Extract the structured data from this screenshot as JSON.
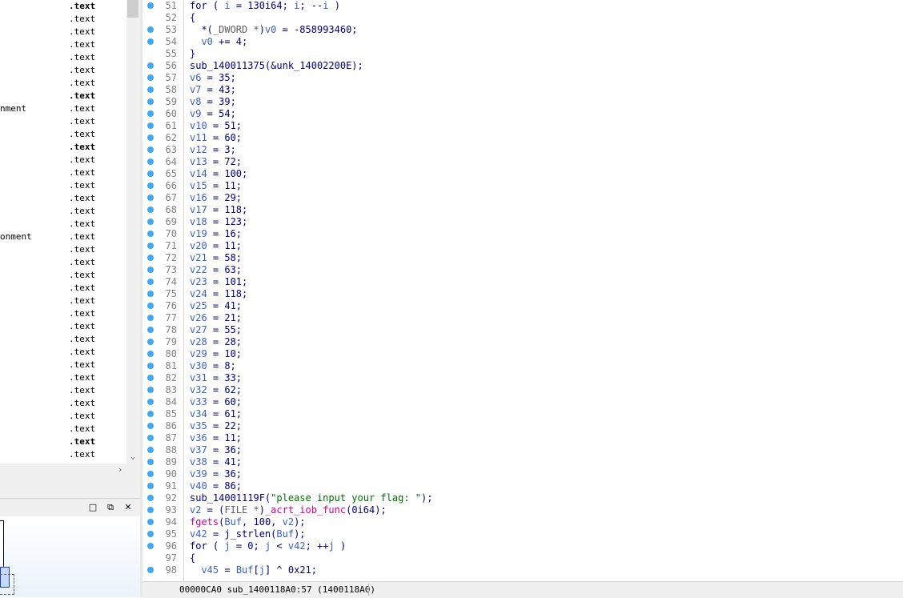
{
  "function_list": {
    "rows": [
      {
        "name": "",
        "segment": ".text",
        "bold": true
      },
      {
        "name": "",
        "segment": ".text",
        "bold": false
      },
      {
        "name": "",
        "segment": ".text",
        "bold": false
      },
      {
        "name": "",
        "segment": ".text",
        "bold": false
      },
      {
        "name": "",
        "segment": ".text",
        "bold": false
      },
      {
        "name": "",
        "segment": ".text",
        "bold": false
      },
      {
        "name": "",
        "segment": ".text",
        "bold": false
      },
      {
        "name": "",
        "segment": ".text",
        "bold": true
      },
      {
        "name": "nment",
        "segment": ".text",
        "bold": false
      },
      {
        "name": "",
        "segment": ".text",
        "bold": false
      },
      {
        "name": "",
        "segment": ".text",
        "bold": false
      },
      {
        "name": "",
        "segment": ".text",
        "bold": true
      },
      {
        "name": "",
        "segment": ".text",
        "bold": false
      },
      {
        "name": "",
        "segment": ".text",
        "bold": false
      },
      {
        "name": "",
        "segment": ".text",
        "bold": false
      },
      {
        "name": "",
        "segment": ".text",
        "bold": false
      },
      {
        "name": "",
        "segment": ".text",
        "bold": false
      },
      {
        "name": "",
        "segment": ".text",
        "bold": false
      },
      {
        "name": "onment",
        "segment": ".text",
        "bold": false
      },
      {
        "name": "",
        "segment": ".text",
        "bold": false
      },
      {
        "name": "",
        "segment": ".text",
        "bold": false
      },
      {
        "name": "",
        "segment": ".text",
        "bold": false
      },
      {
        "name": "",
        "segment": ".text",
        "bold": false
      },
      {
        "name": "",
        "segment": ".text",
        "bold": false
      },
      {
        "name": "",
        "segment": ".text",
        "bold": false
      },
      {
        "name": "",
        "segment": ".text",
        "bold": false
      },
      {
        "name": "",
        "segment": ".text",
        "bold": false
      },
      {
        "name": "",
        "segment": ".text",
        "bold": false
      },
      {
        "name": "",
        "segment": ".text",
        "bold": false
      },
      {
        "name": "",
        "segment": ".text",
        "bold": false
      },
      {
        "name": "",
        "segment": ".text",
        "bold": false
      },
      {
        "name": "",
        "segment": ".text",
        "bold": false
      },
      {
        "name": "",
        "segment": ".text",
        "bold": false
      },
      {
        "name": "",
        "segment": ".text",
        "bold": false
      },
      {
        "name": "",
        "segment": ".text",
        "bold": true
      },
      {
        "name": "",
        "segment": ".text",
        "bold": false
      }
    ],
    "scroll_down_icon": "chevron-down-icon",
    "scroll_right_icon": "chevron-right-icon"
  },
  "graph_panel": {
    "restore_icon": "□",
    "float_icon": "⧉",
    "close_icon": "✕"
  },
  "code": {
    "lines": [
      {
        "n": "51",
        "bp": true,
        "tokens": [
          [
            "kw",
            "for"
          ],
          [
            "p",
            " ( "
          ],
          [
            "var",
            "i"
          ],
          [
            "p",
            " = 130i64; "
          ],
          [
            "var",
            "i"
          ],
          [
            "p",
            "; --"
          ],
          [
            "var",
            "i"
          ],
          [
            "p",
            " )"
          ]
        ]
      },
      {
        "n": "52",
        "bp": false,
        "tokens": [
          [
            "p",
            "{"
          ]
        ]
      },
      {
        "n": "53",
        "bp": true,
        "tokens": [
          [
            "p",
            "  *("
          ],
          [
            "cmt",
            "_DWORD *"
          ],
          [
            "p",
            ")"
          ],
          [
            "var",
            "v0"
          ],
          [
            "p",
            " = -858993460;"
          ]
        ]
      },
      {
        "n": "54",
        "bp": true,
        "tokens": [
          [
            "p",
            "  "
          ],
          [
            "var",
            "v0"
          ],
          [
            "p",
            " += 4;"
          ]
        ]
      },
      {
        "n": "55",
        "bp": false,
        "tokens": [
          [
            "p",
            "}"
          ]
        ]
      },
      {
        "n": "56",
        "bp": true,
        "tokens": [
          [
            "p",
            "sub_140011375(&unk_14002200E);"
          ]
        ]
      },
      {
        "n": "57",
        "bp": true,
        "tokens": [
          [
            "var",
            "v6"
          ],
          [
            "p",
            " = 35;"
          ]
        ]
      },
      {
        "n": "58",
        "bp": true,
        "tokens": [
          [
            "var",
            "v7"
          ],
          [
            "p",
            " = 43;"
          ]
        ]
      },
      {
        "n": "59",
        "bp": true,
        "tokens": [
          [
            "var",
            "v8"
          ],
          [
            "p",
            " = 39;"
          ]
        ]
      },
      {
        "n": "60",
        "bp": true,
        "tokens": [
          [
            "var",
            "v9"
          ],
          [
            "p",
            " = 54;"
          ]
        ]
      },
      {
        "n": "61",
        "bp": true,
        "tokens": [
          [
            "var",
            "v10"
          ],
          [
            "p",
            " = 51;"
          ]
        ]
      },
      {
        "n": "62",
        "bp": true,
        "tokens": [
          [
            "var",
            "v11"
          ],
          [
            "p",
            " = 60;"
          ]
        ]
      },
      {
        "n": "63",
        "bp": true,
        "tokens": [
          [
            "var",
            "v12"
          ],
          [
            "p",
            " = 3;"
          ]
        ]
      },
      {
        "n": "64",
        "bp": true,
        "tokens": [
          [
            "var",
            "v13"
          ],
          [
            "p",
            " = 72;"
          ]
        ]
      },
      {
        "n": "65",
        "bp": true,
        "tokens": [
          [
            "var",
            "v14"
          ],
          [
            "p",
            " = 100;"
          ]
        ]
      },
      {
        "n": "66",
        "bp": true,
        "tokens": [
          [
            "var",
            "v15"
          ],
          [
            "p",
            " = 11;"
          ]
        ]
      },
      {
        "n": "67",
        "bp": true,
        "tokens": [
          [
            "var",
            "v16"
          ],
          [
            "p",
            " = 29;"
          ]
        ]
      },
      {
        "n": "68",
        "bp": true,
        "tokens": [
          [
            "var",
            "v17"
          ],
          [
            "p",
            " = 118;"
          ]
        ]
      },
      {
        "n": "69",
        "bp": true,
        "tokens": [
          [
            "var",
            "v18"
          ],
          [
            "p",
            " = 123;"
          ]
        ]
      },
      {
        "n": "70",
        "bp": true,
        "tokens": [
          [
            "var",
            "v19"
          ],
          [
            "p",
            " = 16;"
          ]
        ]
      },
      {
        "n": "71",
        "bp": true,
        "tokens": [
          [
            "var",
            "v20"
          ],
          [
            "p",
            " = 11;"
          ]
        ]
      },
      {
        "n": "72",
        "bp": true,
        "tokens": [
          [
            "var",
            "v21"
          ],
          [
            "p",
            " = 58;"
          ]
        ]
      },
      {
        "n": "73",
        "bp": true,
        "tokens": [
          [
            "var",
            "v22"
          ],
          [
            "p",
            " = 63;"
          ]
        ]
      },
      {
        "n": "74",
        "bp": true,
        "tokens": [
          [
            "var",
            "v23"
          ],
          [
            "p",
            " = 101;"
          ]
        ]
      },
      {
        "n": "75",
        "bp": true,
        "tokens": [
          [
            "var",
            "v24"
          ],
          [
            "p",
            " = 118;"
          ]
        ]
      },
      {
        "n": "76",
        "bp": true,
        "tokens": [
          [
            "var",
            "v25"
          ],
          [
            "p",
            " = 41;"
          ]
        ]
      },
      {
        "n": "77",
        "bp": true,
        "tokens": [
          [
            "var",
            "v26"
          ],
          [
            "p",
            " = 21;"
          ]
        ]
      },
      {
        "n": "78",
        "bp": true,
        "tokens": [
          [
            "var",
            "v27"
          ],
          [
            "p",
            " = 55;"
          ]
        ]
      },
      {
        "n": "79",
        "bp": true,
        "tokens": [
          [
            "var",
            "v28"
          ],
          [
            "p",
            " = 28;"
          ]
        ]
      },
      {
        "n": "80",
        "bp": true,
        "tokens": [
          [
            "var",
            "v29"
          ],
          [
            "p",
            " = 10;"
          ]
        ]
      },
      {
        "n": "81",
        "bp": true,
        "tokens": [
          [
            "var",
            "v30"
          ],
          [
            "p",
            " = 8;"
          ]
        ]
      },
      {
        "n": "82",
        "bp": true,
        "tokens": [
          [
            "var",
            "v31"
          ],
          [
            "p",
            " = 33;"
          ]
        ]
      },
      {
        "n": "83",
        "bp": true,
        "tokens": [
          [
            "var",
            "v32"
          ],
          [
            "p",
            " = 62;"
          ]
        ]
      },
      {
        "n": "84",
        "bp": true,
        "tokens": [
          [
            "var",
            "v33"
          ],
          [
            "p",
            " = 60;"
          ]
        ]
      },
      {
        "n": "85",
        "bp": true,
        "tokens": [
          [
            "var",
            "v34"
          ],
          [
            "p",
            " = 61;"
          ]
        ]
      },
      {
        "n": "86",
        "bp": true,
        "tokens": [
          [
            "var",
            "v35"
          ],
          [
            "p",
            " = 22;"
          ]
        ]
      },
      {
        "n": "87",
        "bp": true,
        "tokens": [
          [
            "var",
            "v36"
          ],
          [
            "p",
            " = 11;"
          ]
        ]
      },
      {
        "n": "88",
        "bp": true,
        "tokens": [
          [
            "var",
            "v37"
          ],
          [
            "p",
            " = 36;"
          ]
        ]
      },
      {
        "n": "89",
        "bp": true,
        "tokens": [
          [
            "var",
            "v38"
          ],
          [
            "p",
            " = 41;"
          ]
        ]
      },
      {
        "n": "90",
        "bp": true,
        "tokens": [
          [
            "var",
            "v39"
          ],
          [
            "p",
            " = 36;"
          ]
        ]
      },
      {
        "n": "91",
        "bp": true,
        "tokens": [
          [
            "var",
            "v40"
          ],
          [
            "p",
            " = 86;"
          ]
        ]
      },
      {
        "n": "92",
        "bp": true,
        "tokens": [
          [
            "p",
            "sub_14001119F("
          ],
          [
            "str",
            "\"please input your flag: \""
          ],
          [
            "p",
            ");"
          ]
        ]
      },
      {
        "n": "93",
        "bp": true,
        "tokens": [
          [
            "var",
            "v2"
          ],
          [
            "p",
            " = ("
          ],
          [
            "cmt",
            "FILE *"
          ],
          [
            "p",
            ")"
          ],
          [
            "lib",
            "_acrt_iob_func"
          ],
          [
            "p",
            "(0i64);"
          ]
        ]
      },
      {
        "n": "94",
        "bp": true,
        "tokens": [
          [
            "lib",
            "fgets"
          ],
          [
            "p",
            "("
          ],
          [
            "var",
            "Buf"
          ],
          [
            "p",
            ", 100, "
          ],
          [
            "var",
            "v2"
          ],
          [
            "p",
            ");"
          ]
        ]
      },
      {
        "n": "95",
        "bp": true,
        "tokens": [
          [
            "var",
            "v42"
          ],
          [
            "p",
            " = j_strlen("
          ],
          [
            "var",
            "Buf"
          ],
          [
            "p",
            ");"
          ]
        ]
      },
      {
        "n": "96",
        "bp": true,
        "tokens": [
          [
            "kw",
            "for"
          ],
          [
            "p",
            " ( "
          ],
          [
            "var",
            "j"
          ],
          [
            "p",
            " = 0; "
          ],
          [
            "var",
            "j"
          ],
          [
            "p",
            " < "
          ],
          [
            "var",
            "v42"
          ],
          [
            "p",
            "; ++"
          ],
          [
            "var",
            "j"
          ],
          [
            "p",
            " )"
          ]
        ]
      },
      {
        "n": "97",
        "bp": false,
        "tokens": [
          [
            "p",
            "{"
          ]
        ]
      },
      {
        "n": "98",
        "bp": true,
        "tokens": [
          [
            "p",
            "  "
          ],
          [
            "var",
            "v45"
          ],
          [
            "p",
            " = "
          ],
          [
            "var",
            "Buf"
          ],
          [
            "p",
            "["
          ],
          [
            "var",
            "j"
          ],
          [
            "p",
            "] ^ 0x21;"
          ]
        ]
      }
    ]
  },
  "status_bar": {
    "text": "00000CA0 sub_1400118A0:57 (1400118A0)"
  },
  "colors": {
    "breakpoint": "#3fa9f5",
    "keyword": "#000080",
    "variable": "#3a60c8",
    "string": "#007000",
    "library_call": "#d0008c",
    "cast": "#606060"
  }
}
